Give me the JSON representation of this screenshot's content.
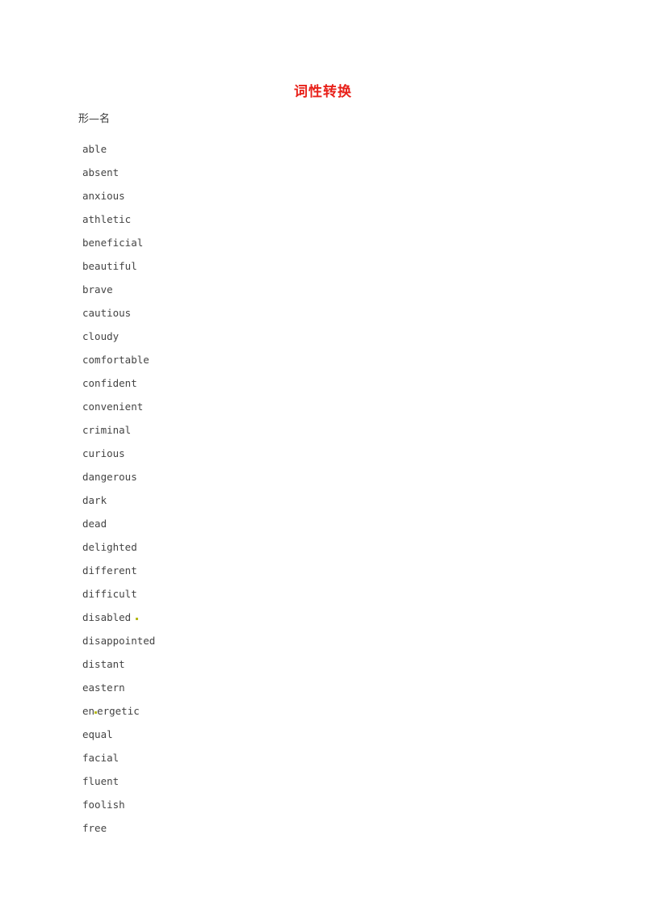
{
  "document": {
    "title": "词性转换",
    "title_color": "#e8211a",
    "section_heading": "形—名",
    "body_color": "#444444"
  },
  "word_list": [
    {
      "word": "able",
      "mark": "none"
    },
    {
      "word": "absent",
      "mark": "none"
    },
    {
      "word": "anxious",
      "mark": "none"
    },
    {
      "word": "athletic",
      "mark": "none"
    },
    {
      "word": "beneficial",
      "mark": "none"
    },
    {
      "word": "beautiful",
      "mark": "none"
    },
    {
      "word": "brave",
      "mark": "none"
    },
    {
      "word": "cautious",
      "mark": "none"
    },
    {
      "word": "cloudy",
      "mark": "none"
    },
    {
      "word": "comfortable",
      "mark": "none"
    },
    {
      "word": "confident",
      "mark": "none"
    },
    {
      "word": "convenient",
      "mark": "none"
    },
    {
      "word": "criminal",
      "mark": "none"
    },
    {
      "word": "curious",
      "mark": "none"
    },
    {
      "word": "dangerous",
      "mark": "none"
    },
    {
      "word": "dark",
      "mark": "none"
    },
    {
      "word": "dead",
      "mark": "none"
    },
    {
      "word": "delighted",
      "mark": "none"
    },
    {
      "word": "different",
      "mark": "none"
    },
    {
      "word": "difficult",
      "mark": "none"
    },
    {
      "word": "disabled",
      "mark": "trailing-dot"
    },
    {
      "word": "disappointed",
      "mark": "none"
    },
    {
      "word": "distant",
      "mark": "none"
    },
    {
      "word": "eastern",
      "mark": "none"
    },
    {
      "word": "energetic",
      "mark": "inline-dot",
      "mark_after": 2
    },
    {
      "word": "equal",
      "mark": "none"
    },
    {
      "word": "facial",
      "mark": "none"
    },
    {
      "word": "fluent",
      "mark": "none"
    },
    {
      "word": "foolish",
      "mark": "none"
    },
    {
      "word": "free",
      "mark": "none"
    }
  ],
  "annotations": {
    "dot_color": "#b5b818"
  }
}
